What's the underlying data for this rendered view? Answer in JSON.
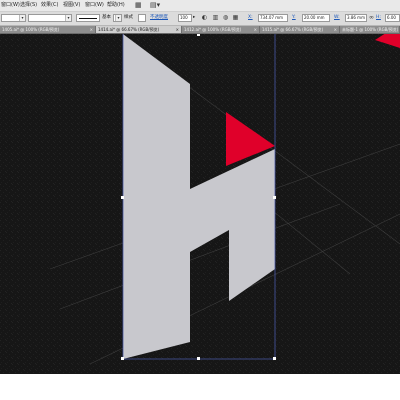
{
  "menubar": {
    "items": [
      "窗口(W)",
      "选择(S)",
      "效果(C)",
      "视图(V)",
      "窗口(W)",
      "帮助(H)"
    ],
    "icons": [
      "workspace-icon",
      "arrange-icon"
    ]
  },
  "controlbar": {
    "fill_field": "",
    "stroke_field": "",
    "stroke_style": "基本",
    "opacity_label": "不透明度",
    "opacity_value": "100",
    "x_value": "734.07 mm",
    "y_value": "20.00 mm",
    "w_value": "3.86 mm",
    "h_value": "6.00"
  },
  "tabs": [
    {
      "label": "1405.ai* @ 100% (RGB/预览)",
      "active": false
    },
    {
      "label": "1414.ai* @ 66.67% (RGB/预览)",
      "active": true
    },
    {
      "label": "1412.ai* @ 100% (RGB/预览)",
      "active": false
    },
    {
      "label": "1415.ai* @ 66.67% (RGB/预览)",
      "active": false
    },
    {
      "label": "未标题-1 @ 100% (RGB/预览)",
      "active": false
    }
  ],
  "artwork": {
    "background_color": "#171717",
    "letter_color": "#c8c8cd",
    "accent_color": "#e0002a",
    "selection_color": "#4a5aa8"
  }
}
